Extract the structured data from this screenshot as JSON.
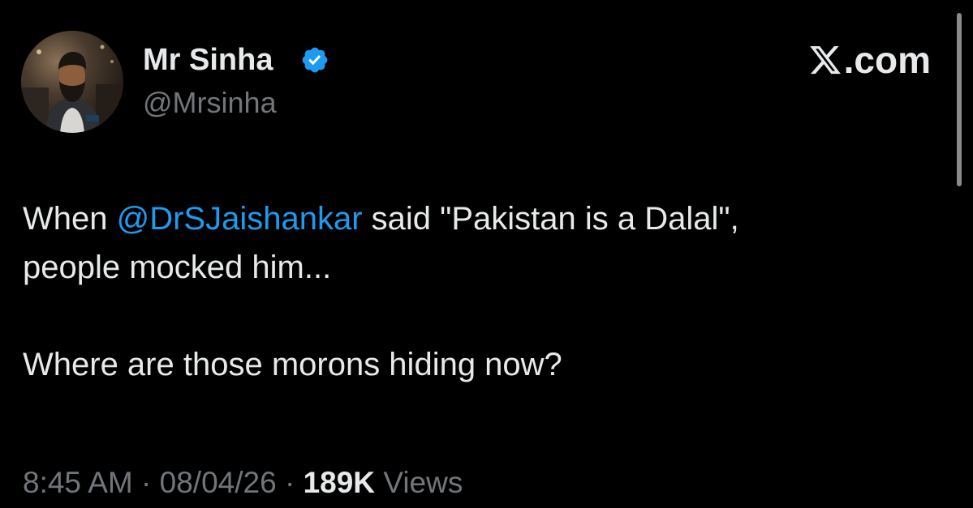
{
  "author": {
    "display_name": "Mr Sinha",
    "handle": "@Mrsinha",
    "verified": true,
    "verified_color": "#1d9bf0"
  },
  "brand": {
    "label": ".com",
    "icon": "x-logo-icon"
  },
  "tweet": {
    "line1_prefix": "When ",
    "mention": "@DrSJaishankar",
    "line1_suffix": " said \"Pakistan is a Dalal\",",
    "line2": "people mocked him...",
    "line3": "Where are those morons hiding now?"
  },
  "meta": {
    "time": "8:45 AM",
    "date": "08/04/26",
    "separator": "·",
    "views_count": "189K",
    "views_label": "Views"
  },
  "colors": {
    "background": "#000000",
    "text": "#e7e9ea",
    "muted": "#71767b",
    "accent": "#1d9bf0"
  }
}
